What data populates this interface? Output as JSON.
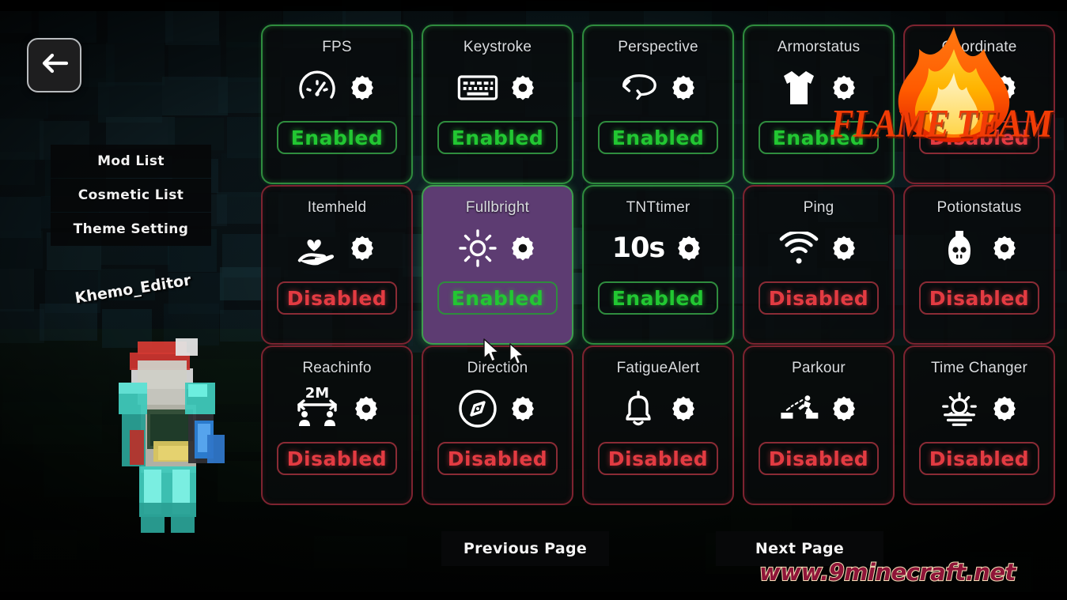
{
  "window": {
    "title": "Mod List",
    "back_icon": "arrow-left-icon"
  },
  "side_menu": {
    "items": [
      {
        "label": "Mod List",
        "name": "mod-list"
      },
      {
        "label": "Cosmetic List",
        "name": "cosmetic-list"
      },
      {
        "label": "Theme Setting",
        "name": "theme-setting"
      }
    ]
  },
  "player": {
    "name_tag": "Khemo_Editor"
  },
  "colors": {
    "enabled_green": "#22c732",
    "enabled_border": "#2f8c3e",
    "disabled_red": "#e33b42",
    "disabled_border": "#8a2b35",
    "hover_purple": "#5d3c72",
    "card_bg": "#090b0d",
    "title_text": "#d9dcdf"
  },
  "mods": [
    {
      "label": "FPS",
      "icon": "speedometer-icon",
      "status": "Enabled",
      "state": "on",
      "hover": false
    },
    {
      "label": "Keystroke",
      "icon": "keyboard-icon",
      "status": "Enabled",
      "state": "on",
      "hover": false
    },
    {
      "label": "Perspective",
      "icon": "rotate-icon",
      "status": "Enabled",
      "state": "on",
      "hover": false
    },
    {
      "label": "Armorstatus",
      "icon": "chestplate-icon",
      "status": "Enabled",
      "state": "on",
      "hover": false
    },
    {
      "label": "Coordinate",
      "icon": "signal-icon",
      "status": "Disabled",
      "state": "off",
      "hover": false
    },
    {
      "label": "Itemheld",
      "icon": "hand-heart-icon",
      "status": "Disabled",
      "state": "off",
      "hover": false
    },
    {
      "label": "Fullbright",
      "icon": "sun-icon",
      "status": "Enabled",
      "state": "on",
      "hover": true
    },
    {
      "label": "TNTtimer",
      "icon": "text-10s-icon",
      "status": "Enabled",
      "state": "on",
      "hover": false,
      "icon_text": "10s"
    },
    {
      "label": "Ping",
      "icon": "wifi-icon",
      "status": "Disabled",
      "state": "off",
      "hover": false
    },
    {
      "label": "Potionstatus",
      "icon": "potion-skull-icon",
      "status": "Disabled",
      "state": "off",
      "hover": false
    },
    {
      "label": "Reachinfo",
      "icon": "reach-distance-icon",
      "status": "Disabled",
      "state": "off",
      "hover": false,
      "icon_text": "2M"
    },
    {
      "label": "Direction",
      "icon": "compass-icon",
      "status": "Disabled",
      "state": "off",
      "hover": false
    },
    {
      "label": "FatigueAlert",
      "icon": "bell-icon",
      "status": "Disabled",
      "state": "off",
      "hover": false
    },
    {
      "label": "Parkour",
      "icon": "parkour-jump-icon",
      "status": "Disabled",
      "state": "off",
      "hover": false
    },
    {
      "label": "Time Changer",
      "icon": "sunset-icon",
      "status": "Disabled",
      "state": "off",
      "hover": false
    }
  ],
  "gear_icon_name": "gear-icon",
  "pagination": {
    "previous_label": "Previous Page",
    "next_label": "Next Page"
  },
  "watermarks": {
    "flame_team": "FLAME TEAM",
    "site": "www.9minecraft.net"
  }
}
